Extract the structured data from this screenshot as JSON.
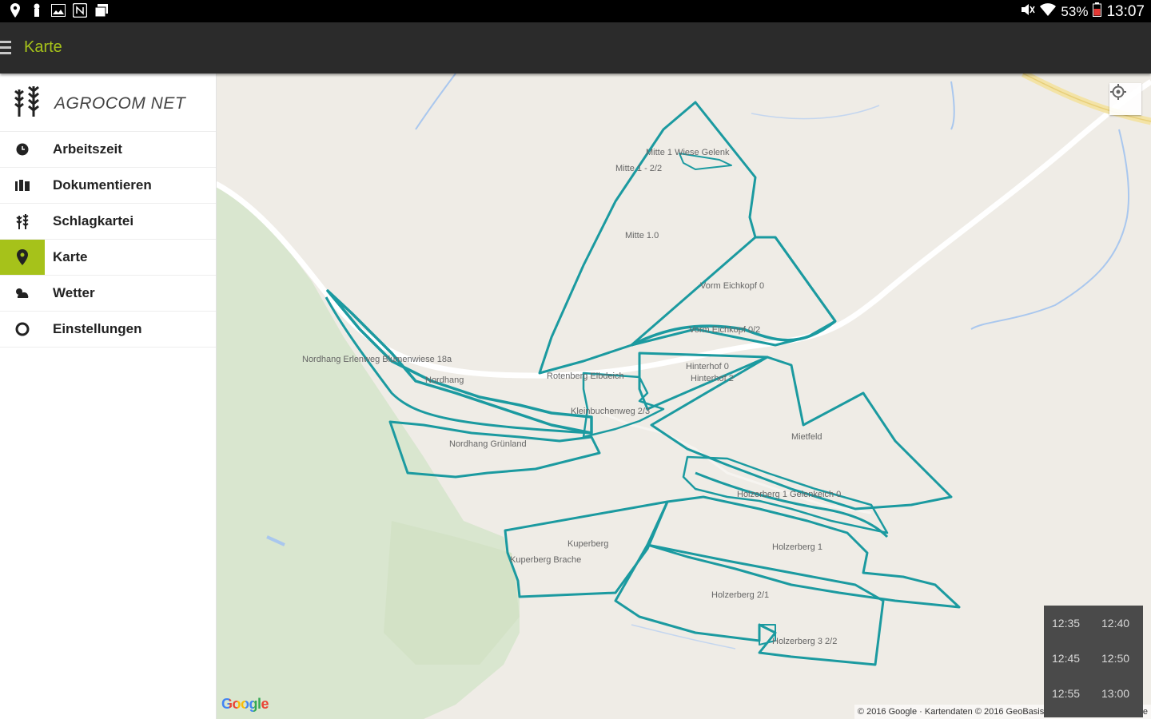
{
  "status_bar": {
    "battery": "53%",
    "time": "13:07",
    "left_icons": [
      "location-icon",
      "notification-icon",
      "image-icon",
      "nfc-icon",
      "gallery-icon"
    ]
  },
  "app_bar": {
    "title": "Karte"
  },
  "drawer": {
    "logo_text": "AGROCOM NET",
    "items": [
      {
        "label": "Arbeitszeit",
        "icon": "clock-icon"
      },
      {
        "label": "Dokumentieren",
        "icon": "document-icon"
      },
      {
        "label": "Schlagkartei",
        "icon": "wheat-icon"
      },
      {
        "label": "Karte",
        "icon": "map-pin-icon"
      },
      {
        "label": "Wetter",
        "icon": "weather-icon"
      },
      {
        "label": "Einstellungen",
        "icon": "settings-icon"
      }
    ],
    "active_index": 3
  },
  "map": {
    "field_labels": [
      "Mitte 1 Wiese Gelenk",
      "Mitte 1 - 2/2",
      "Mitte 1.0",
      "Vorm Eichkopf 0",
      "Vorm Eichkopf 0/2",
      "Nordhang Erlenweg Blumenwiese 18a",
      "Nordhang",
      "Rotenberg Elbdeich",
      "Kleinbuchenweg 2/3",
      "Hinterhof 0",
      "Hinterhof 2",
      "Nordhang Grünland",
      "Mietfeld",
      "Holzerberg 1 Gelenkeich 0",
      "Holzerberg 1",
      "Kuperberg",
      "Kuperberg Brache",
      "Holzerberg 2/1",
      "Holzerberg 3 2/2"
    ],
    "google_logo": "Google",
    "attribution": "© 2016 Google · Kartendaten © 2016 GeoBasis-DE/BKG (©2009), Google",
    "accent_color": "#1b9aa0"
  },
  "time_panel": {
    "times": [
      "12:35",
      "12:40",
      "12:45",
      "12:50",
      "12:55",
      "13:00"
    ]
  },
  "colors": {
    "accent": "#a6c21a",
    "appbar": "#2b2b2b",
    "field_outline": "#1b9aa0"
  }
}
